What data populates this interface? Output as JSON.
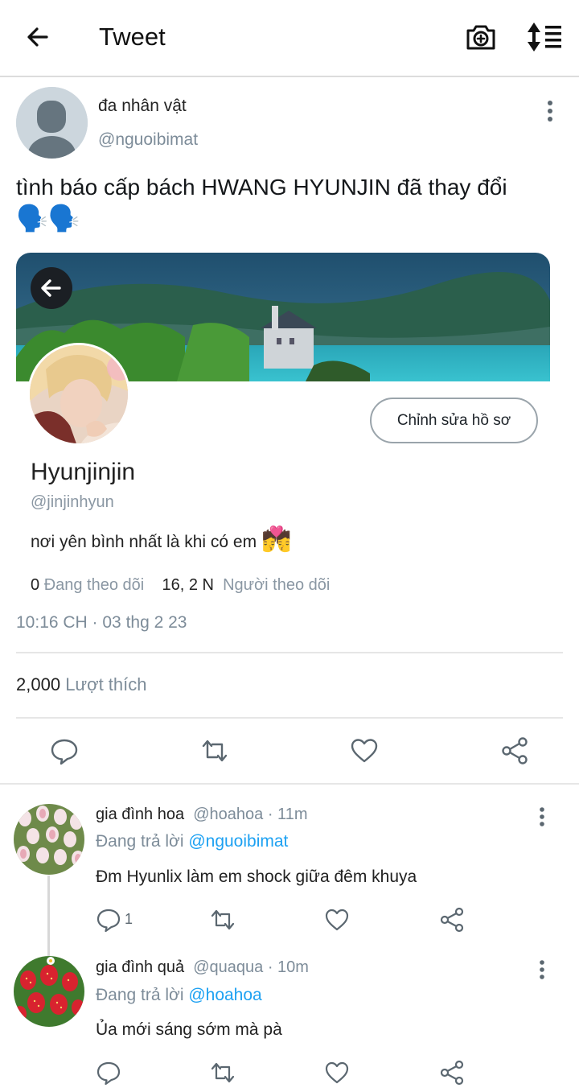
{
  "header": {
    "title": "Tweet"
  },
  "tweet": {
    "author_name": "đa nhân vật",
    "author_handle": "@nguoibimat",
    "text": "tình báo cấp bách HWANG HYUNJIN đã thay đổi",
    "emoji": "🗣️🗣️",
    "timestamp": "10:16 CH · 03 thg 2 23",
    "likes_count": "2,000",
    "likes_label": "Lượt thích"
  },
  "card": {
    "edit_button": "Chỉnh sửa hồ sơ",
    "name": "Hyunjinjin",
    "handle": "@jinjinhyun",
    "bio": "nơi yên bình nhất là khi có em",
    "bio_emoji": "💏",
    "following_count": "0",
    "following_label": "Đang theo dõi",
    "followers_count": "16, 2 N",
    "followers_label": "Người theo dõi"
  },
  "replies": [
    {
      "name": "gia đình hoa",
      "handle": "@hoahoa",
      "time": "· 11m",
      "replying_label": "Đang trả lời",
      "replying_to": "@nguoibimat",
      "text": "Đm Hyunlix làm em shock giữa đêm khuya",
      "reply_count": "1"
    },
    {
      "name": "gia đình quả",
      "handle": "@quaqua",
      "time": "· 10m",
      "replying_label": "Đang trả lời",
      "replying_to": "@hoahoa",
      "text": "Ủa mới sáng sớm mà pà",
      "reply_count": ""
    }
  ],
  "colors": {
    "accent": "#1da1f2",
    "secondary_text": "#7d8c99",
    "divider": "#e6e6e6"
  },
  "icons": [
    "arrow-left-icon",
    "camera-plus-icon",
    "sort-icon",
    "more-vertical-icon",
    "reply-icon",
    "retweet-icon",
    "heart-icon",
    "share-icon"
  ]
}
